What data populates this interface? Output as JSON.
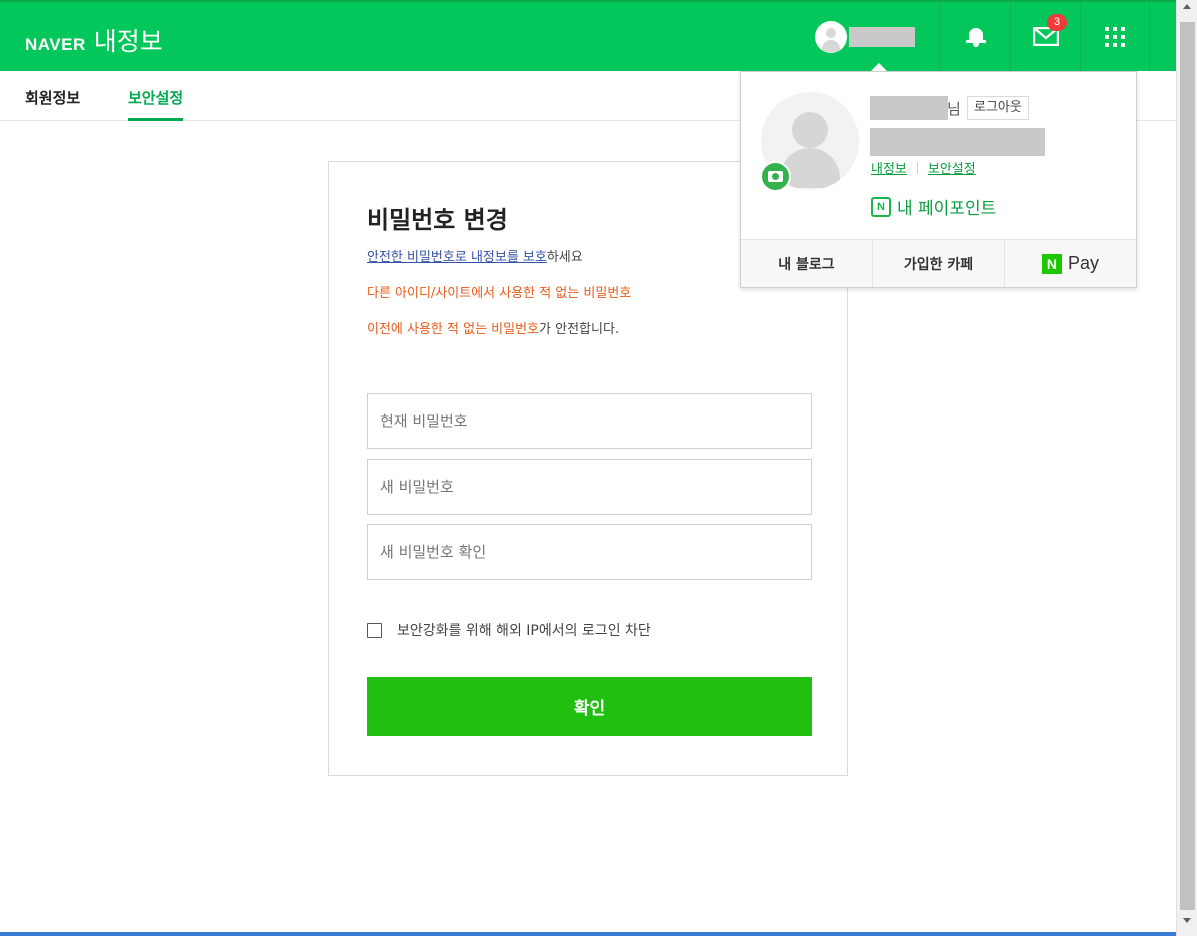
{
  "header": {
    "brand": "NAVER",
    "title": "내정보",
    "mail_count": "3",
    "accent_color": "#03c75a"
  },
  "tabs": [
    {
      "label": "회원정보",
      "active": false
    },
    {
      "label": "보안설정",
      "active": true
    }
  ],
  "form": {
    "title": "비밀번호 변경",
    "line1_link": "안전한 비밀번호로 내정보를 보호",
    "line1_rest": "하세요",
    "line2": "다른 아이디/사이트에서 사용한 적 없는 비밀번호",
    "line3_highlight": "이전에 사용한 적 없는 비밀번호",
    "line3_rest": "가 안전합니다.",
    "current_password_placeholder": "현재 비밀번호",
    "new_password_placeholder": "새 비밀번호",
    "confirm_password_placeholder": "새 비밀번호 확인",
    "block_overseas_label": "보안강화를 위해 해외 IP에서의 로그인 차단",
    "block_overseas_checked": false,
    "submit_label": "확인",
    "submit_color": "#20bf10"
  },
  "popup": {
    "name_suffix": "님",
    "logout_label": "로그아웃",
    "link_myinfo": "내정보",
    "link_security": "보안설정",
    "pay_point_icon": "N",
    "pay_point_label": "내 페이포인트",
    "footer": {
      "blog": "내 블로그",
      "cafe": "가입한 카페",
      "npay_icon": "N",
      "npay_label": "Pay"
    }
  }
}
